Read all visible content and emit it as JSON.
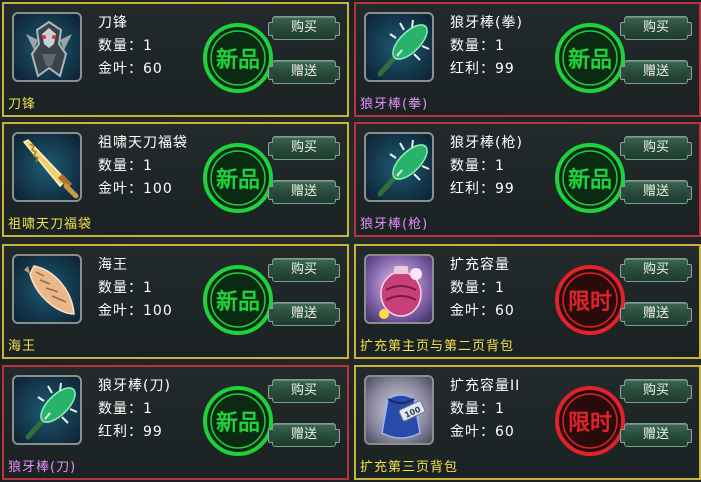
{
  "colors": {
    "new_badge": "#1fd13a",
    "limited_badge": "#e0222a",
    "gold_border": "#c9b43a",
    "red_border": "#b8343c"
  },
  "items": [
    {
      "slot": "r0c0",
      "name": "刀锋",
      "qty_label": "数量：1",
      "price_label": "金叶：60",
      "footer": "刀锋",
      "badge": "新品",
      "buy": "购买",
      "gift": "赠送",
      "icon": "armor-icon"
    },
    {
      "slot": "r0c1",
      "name": "狼牙棒(拳)",
      "qty_label": "数量：1",
      "price_label": "红利：99",
      "footer": "狼牙棒(拳)",
      "badge": "新品",
      "buy": "购买",
      "gift": "赠送",
      "icon": "spiked-club-icon"
    },
    {
      "slot": "r1c0",
      "name": "祖啸天刀福袋",
      "qty_label": "数量：1",
      "price_label": "金叶：100",
      "footer": "祖啸天刀福袋",
      "badge": "新品",
      "buy": "购买",
      "gift": "赠送",
      "icon": "golden-sword-icon"
    },
    {
      "slot": "r1c1",
      "name": "狼牙棒(枪)",
      "qty_label": "数量：1",
      "price_label": "红利：99",
      "footer": "狼牙棒(枪)",
      "badge": "新品",
      "buy": "购买",
      "gift": "赠送",
      "icon": "spiked-club-icon"
    },
    {
      "slot": "r2c0",
      "name": "海王",
      "qty_label": "数量：1",
      "price_label": "金叶：100",
      "footer": "海王",
      "badge": "新品",
      "buy": "购买",
      "gift": "赠送",
      "icon": "conch-shell-icon"
    },
    {
      "slot": "r2c1",
      "name": "扩充容量",
      "qty_label": "数量：1",
      "price_label": "金叶：60",
      "footer": "扩充第主页与第二页背包",
      "badge": "限时",
      "buy": "购买",
      "gift": "赠送",
      "icon": "lantern-bag-icon"
    },
    {
      "slot": "r3c0",
      "name": "狼牙棒(刀)",
      "qty_label": "数量：1",
      "price_label": "红利：99",
      "footer": "狼牙棒(刀)",
      "badge": "新品",
      "buy": "购买",
      "gift": "赠送",
      "icon": "spiked-club-icon"
    },
    {
      "slot": "r3c1",
      "name": "扩充容量II",
      "qty_label": "数量：1",
      "price_label": "金叶：60",
      "footer": "扩充第三页背包",
      "badge": "限时",
      "buy": "购买",
      "gift": "赠送",
      "icon": "blue-pouch-icon"
    }
  ]
}
